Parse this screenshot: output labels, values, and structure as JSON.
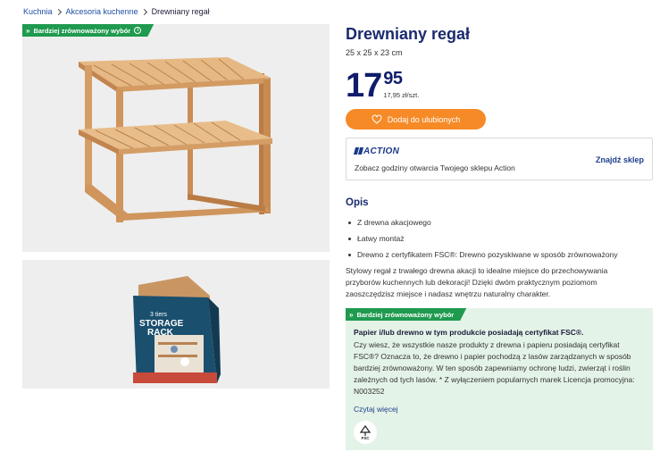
{
  "breadcrumb": {
    "items": [
      "Kuchnia",
      "Akcesoria kuchenne",
      "Drewniany regał"
    ]
  },
  "badge": {
    "label": "Bardziej zrównoważony wybór",
    "color": "#1f9a4f"
  },
  "product": {
    "title": "Drewniany regał",
    "dimensions": "25 x 25 x 23 cm",
    "price_int": "17",
    "price_dec": "95",
    "unit_price": "17,95 zł/szt.",
    "favorite_button": "Dodaj do ulubionych",
    "package_text": {
      "small": "3 tiers",
      "big1": "STORAGE",
      "big2": "RACK"
    }
  },
  "store": {
    "logo": "ACTION",
    "text": "Zobacz godziny otwarcia Twojego sklepu Action",
    "find": "Znajdź sklep"
  },
  "description": {
    "heading": "Opis",
    "bullets": [
      "Z drewna akacjowego",
      "Łatwy montaż",
      "Drewno z certyfikatem FSC®: Drewno pozyskiwane w sposób zrównoważony"
    ],
    "paragraph": "Stylowy regał z trwałego drewna akacji to idealne miejsce do przechowywania przyborów kuchennych lub dekoracji! Dzięki dwóm praktycznym poziomom zaoszczędzisz miejsce i nadasz wnętrzu naturalny charakter."
  },
  "sustainability": {
    "title": "Papier i/lub drewno w tym produkcie posiadają certyfikat FSC®.",
    "text": "Czy wiesz, że wszystkie nasze produkty z drewna i papieru posiadają certyfikat FSC®? Oznacza to, że drewno i papier pochodzą z lasów zarządzanych w sposób bardziej zrównoważony. W ten sposób zapewniamy ochronę ludzi, zwierząt i roślin zależnych od tych lasów. * Z wyłączeniem popularnych marek Licencja promocyjna: N003252",
    "more": "Czytaj więcej",
    "logo_label": "FSC"
  },
  "colors": {
    "accent_orange": "#f68a27",
    "brand_navy": "#0f1c6b",
    "eco_green": "#1f9a4f",
    "eco_bg": "#e4f3e7"
  }
}
